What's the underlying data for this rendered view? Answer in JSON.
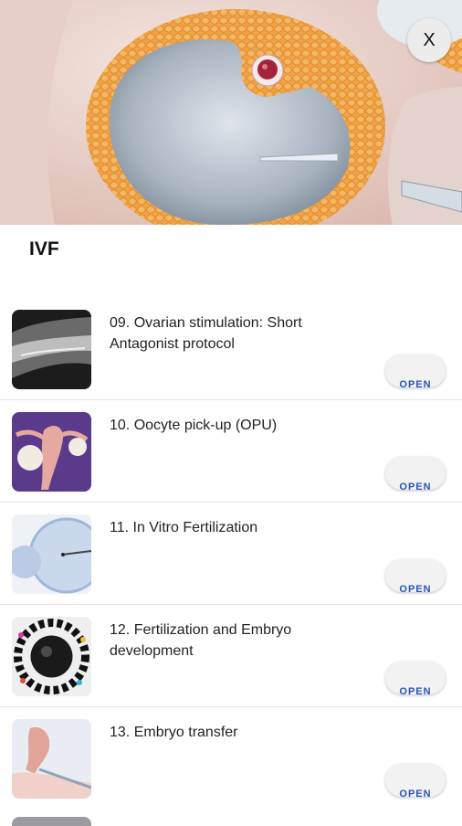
{
  "header": {
    "close_label": "X"
  },
  "page": {
    "title": "IVF"
  },
  "items": [
    {
      "title": "09. Ovarian stimulation: Short Antagonist protocol",
      "button": "OPEN",
      "thumb_icon": "ultrasound-thumbnail"
    },
    {
      "title": "10. Oocyte pick-up (OPU)",
      "button": "OPEN",
      "thumb_icon": "ovary-anatomy-thumbnail"
    },
    {
      "title": "11. In Vitro Fertilization",
      "button": "OPEN",
      "thumb_icon": "egg-injection-thumbnail"
    },
    {
      "title": "12. Fertilization and Embryo development",
      "button": "OPEN",
      "thumb_icon": "embryo-stages-thumbnail"
    },
    {
      "title": "13. Embryo transfer",
      "button": "OPEN",
      "thumb_icon": "uterus-transfer-thumbnail"
    }
  ],
  "colors": {
    "accent": "#2a54b5",
    "follicle": "#f2a444",
    "background": "#ffffff"
  }
}
